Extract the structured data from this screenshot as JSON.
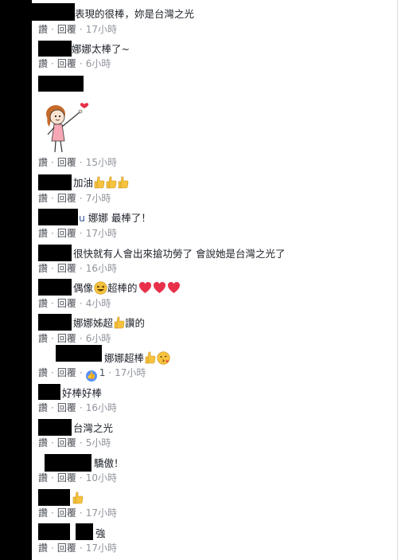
{
  "actions": {
    "like": "讚",
    "reply": "回覆",
    "separator": "·"
  },
  "comments": [
    {
      "text": "表現的很棒，妳是台灣之光",
      "time": "17小時"
    },
    {
      "text": "娜娜太棒了~",
      "time": "6小時"
    },
    {
      "text": "",
      "time": "15小時",
      "sticker": "girl-pointing-sticker"
    },
    {
      "text": "加油",
      "time": "7小時",
      "emoji": [
        "thumbs-up",
        "thumbs-up",
        "thumbs-up"
      ]
    },
    {
      "text": "娜娜 最棒了！",
      "prefix": "u",
      "time": "17小時"
    },
    {
      "text": "很快就有人會出來搶功勞了 會說她是台灣之光了",
      "time": "16小時"
    },
    {
      "text_before": "偶像",
      "text_after": "超棒的",
      "time": "4小時",
      "emoji": [
        "laughing",
        "heart",
        "heart",
        "heart"
      ]
    },
    {
      "text_before": "娜娜姊超",
      "text_after": "讚的",
      "time": "6小時",
      "emoji": [
        "thumbs-up"
      ]
    },
    {
      "text": "娜娜超棒",
      "time": "17小時",
      "likes": "1",
      "emoji": [
        "thumbs-up",
        "kissing-face"
      ]
    },
    {
      "text": "好棒好棒",
      "time": "16小時"
    },
    {
      "text": "台灣之光",
      "time": "5小時"
    },
    {
      "text": "驕傲！",
      "time": "10小時"
    },
    {
      "text": "",
      "time": "17小時",
      "emoji": [
        "thumbs-up"
      ]
    },
    {
      "text": "強",
      "time": "17小時"
    }
  ],
  "colors": {
    "text": "#1d2129",
    "meta": "#90949c",
    "link": "#4b4f56",
    "like_blue": "#5890ff",
    "heart_red": "#e8304a",
    "emoji_yellow": "#f7c23d"
  }
}
